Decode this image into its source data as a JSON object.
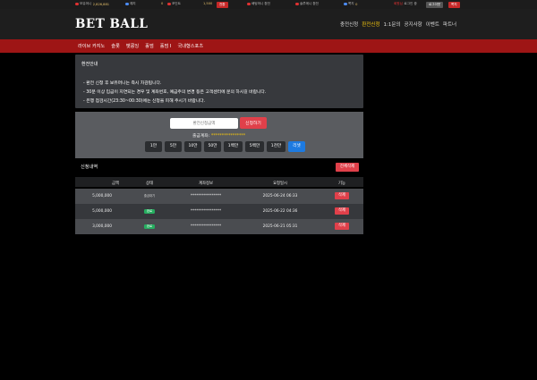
{
  "topbar": {
    "money_label": "보유머니",
    "money_value": "2,826,881",
    "deposit_link": "예치",
    "casino_count": "0",
    "point_label": "포인트",
    "point_value": "1,500",
    "convert_btn": "전환",
    "bet_history": "배팅머니 환전",
    "bet_list": "솔루메니 환전",
    "msg_label": "쪽지",
    "msg_count": "0",
    "user_name": "회원님",
    "welcome": "로그인 중",
    "logout_btn": "로그아웃"
  },
  "header": {
    "logo": "BET BALL",
    "nav": [
      "충전신청",
      "환전신청",
      "1:1문의",
      "공지사항",
      "이벤트",
      "파트너"
    ],
    "active_nav": "환전신청"
  },
  "subnav": {
    "items": [
      "라이브 카지노",
      "슬롯",
      "벳콩잉",
      "홀덤",
      "홀덤 I",
      "국내형스포츠"
    ]
  },
  "notice": {
    "title": "환전안내",
    "lines": [
      "- 환전 신청 후 보유머니는 즉시 차감됩니다.",
      "- 30분 이상 입금이 지연되는 경우 및 계좌번호, 예금주의 변경 등은 고객센터에 문의 하시길 바랍니다.",
      "- 은행 점검시간(23:30~00:30)에는 신청을 피해 주시기 바랍니다."
    ]
  },
  "apply": {
    "amount_placeholder": "환전신청금액",
    "submit_label": "신청하기",
    "account_label": "출금계좌:",
    "account_value": "****************",
    "quick_amounts": [
      "1만",
      "5만",
      "10만",
      "50만",
      "1백만",
      "5백만",
      "1천만"
    ],
    "reset_label": "리셋"
  },
  "history": {
    "title": "신청내역",
    "delete_all": "전체삭제",
    "columns": [
      "금액",
      "상태",
      "계좌정보",
      "요청일시",
      "기능"
    ],
    "rows": [
      {
        "amount": "5,000,000",
        "status": "출금대기",
        "status_type": "wait",
        "account": "****************",
        "date": "2025-06-24 06:33",
        "action": "삭제"
      },
      {
        "amount": "5,000,000",
        "status": "완료",
        "status_type": "done",
        "account": "****************",
        "date": "2025-06-22 04:36",
        "action": "삭제"
      },
      {
        "amount": "3,000,000",
        "status": "완료",
        "status_type": "done",
        "account": "****************",
        "date": "2025-06-21 05:31",
        "action": "삭제"
      }
    ]
  },
  "colors": {
    "brand_red": "#9e1515",
    "accent_yellow": "#f1c40f",
    "button_red": "#e0404a",
    "reset_blue": "#1d7ae0",
    "status_green": "#27ae60"
  }
}
